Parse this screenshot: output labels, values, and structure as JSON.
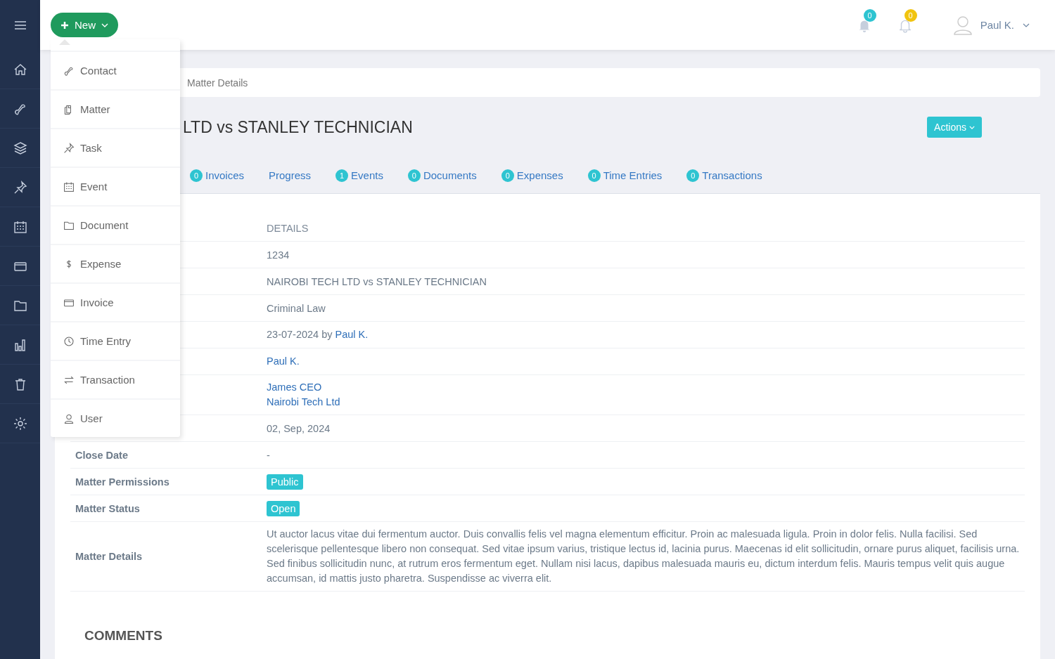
{
  "topbar": {
    "new_button": "New",
    "notifications": [
      {
        "count": "0",
        "color": "#2ec4d1"
      },
      {
        "count": "0",
        "color": "#f1c40f"
      }
    ],
    "user": "Paul K."
  },
  "new_menu": [
    {
      "label": "Contact"
    },
    {
      "label": "Matter"
    },
    {
      "label": "Task"
    },
    {
      "label": "Event"
    },
    {
      "label": "Document"
    },
    {
      "label": "Expense"
    },
    {
      "label": "Invoice"
    },
    {
      "label": "Time Entry"
    },
    {
      "label": "Transaction"
    },
    {
      "label": "User"
    }
  ],
  "breadcrumb": "Matter Details",
  "title": "LTD vs STANLEY TECHNICIAN",
  "actions_button": "Actions",
  "tabs": [
    {
      "label": "Invoices",
      "count": "0"
    },
    {
      "label": "Progress"
    },
    {
      "label": "Events",
      "count": "1"
    },
    {
      "label": "Documents",
      "count": "0"
    },
    {
      "label": "Expenses",
      "count": "0"
    },
    {
      "label": "Time Entries",
      "count": "0"
    },
    {
      "label": "Transactions",
      "count": "0"
    }
  ],
  "details": {
    "column_2": "DETAILS",
    "rows": [
      {
        "kind": "text",
        "value": "1234"
      },
      {
        "kind": "text",
        "value": "NAIROBI TECH LTD vs STANLEY TECHNICIAN"
      },
      {
        "kind": "text",
        "value": "Criminal Law"
      },
      {
        "kind": "byline",
        "value": "23-07-2024 by",
        "link": "Paul K."
      },
      {
        "kind": "links",
        "links": [
          "Paul K."
        ]
      },
      {
        "kind": "links",
        "links": [
          "James CEO",
          "Nairobi Tech Ltd"
        ]
      },
      {
        "kind": "text",
        "value": "02, Sep, 2024"
      },
      {
        "kind": "text",
        "label": "Close Date",
        "value": "-"
      },
      {
        "kind": "badge",
        "label": "Matter Permissions",
        "value": "Public"
      },
      {
        "kind": "badge",
        "label": "Matter Status",
        "value": "Open"
      },
      {
        "kind": "text",
        "label": "Matter Details",
        "value": "Ut auctor lacus vitae dui fermentum auctor. Duis convallis felis vel magna elementum efficitur. Proin ac malesuada ligula. Proin in dolor felis. Nulla facilisi. Sed scelerisque pellentesque libero non consequat. Sed vitae ipsum varius, tristique lectus id, lacinia purus. Maecenas id elit sollicitudin, ornare purus aliquet, facilisis urna. Sed finibus sollicitudin nunc, at rutrum eros fermentum eget. Nullam nisi lacus, dapibus malesuada mauris eu, dictum interdum felis. Mauris tempus velit quis augue accumsan, id mattis justo pharetra. Suspendisse ac viverra elit."
      }
    ]
  },
  "comments_heading": "COMMENTS"
}
